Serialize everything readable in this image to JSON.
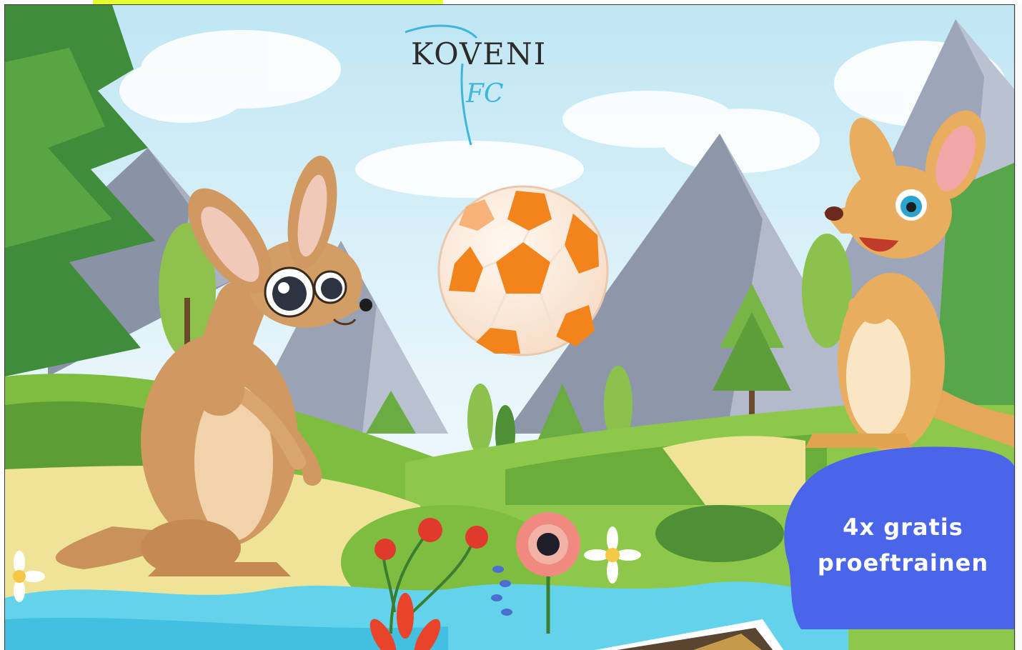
{
  "logo": {
    "wordmark": "KOVENI",
    "sub_mark": "FC"
  },
  "promo": {
    "line1": "4x gratis",
    "line2": "proeftrainen"
  },
  "colors": {
    "highlight": "#e6ff2e",
    "badge": "#4a64ea",
    "water": "#63d3ec",
    "ball_orange": "#f3841c"
  }
}
